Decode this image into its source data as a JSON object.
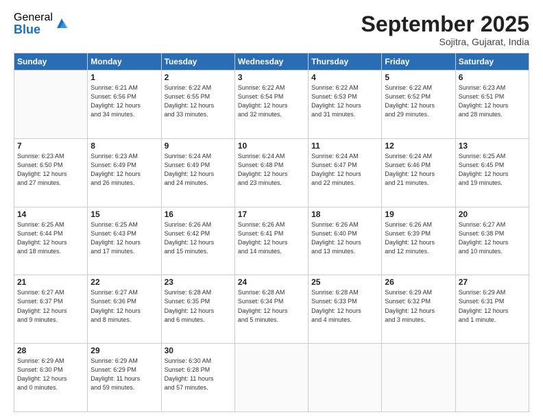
{
  "logo": {
    "general": "General",
    "blue": "Blue"
  },
  "header": {
    "month": "September 2025",
    "location": "Sojitra, Gujarat, India"
  },
  "weekdays": [
    "Sunday",
    "Monday",
    "Tuesday",
    "Wednesday",
    "Thursday",
    "Friday",
    "Saturday"
  ],
  "weeks": [
    [
      {
        "day": "",
        "info": ""
      },
      {
        "day": "1",
        "info": "Sunrise: 6:21 AM\nSunset: 6:56 PM\nDaylight: 12 hours\nand 34 minutes."
      },
      {
        "day": "2",
        "info": "Sunrise: 6:22 AM\nSunset: 6:55 PM\nDaylight: 12 hours\nand 33 minutes."
      },
      {
        "day": "3",
        "info": "Sunrise: 6:22 AM\nSunset: 6:54 PM\nDaylight: 12 hours\nand 32 minutes."
      },
      {
        "day": "4",
        "info": "Sunrise: 6:22 AM\nSunset: 6:53 PM\nDaylight: 12 hours\nand 31 minutes."
      },
      {
        "day": "5",
        "info": "Sunrise: 6:22 AM\nSunset: 6:52 PM\nDaylight: 12 hours\nand 29 minutes."
      },
      {
        "day": "6",
        "info": "Sunrise: 6:23 AM\nSunset: 6:51 PM\nDaylight: 12 hours\nand 28 minutes."
      }
    ],
    [
      {
        "day": "7",
        "info": "Sunrise: 6:23 AM\nSunset: 6:50 PM\nDaylight: 12 hours\nand 27 minutes."
      },
      {
        "day": "8",
        "info": "Sunrise: 6:23 AM\nSunset: 6:49 PM\nDaylight: 12 hours\nand 26 minutes."
      },
      {
        "day": "9",
        "info": "Sunrise: 6:24 AM\nSunset: 6:49 PM\nDaylight: 12 hours\nand 24 minutes."
      },
      {
        "day": "10",
        "info": "Sunrise: 6:24 AM\nSunset: 6:48 PM\nDaylight: 12 hours\nand 23 minutes."
      },
      {
        "day": "11",
        "info": "Sunrise: 6:24 AM\nSunset: 6:47 PM\nDaylight: 12 hours\nand 22 minutes."
      },
      {
        "day": "12",
        "info": "Sunrise: 6:24 AM\nSunset: 6:46 PM\nDaylight: 12 hours\nand 21 minutes."
      },
      {
        "day": "13",
        "info": "Sunrise: 6:25 AM\nSunset: 6:45 PM\nDaylight: 12 hours\nand 19 minutes."
      }
    ],
    [
      {
        "day": "14",
        "info": "Sunrise: 6:25 AM\nSunset: 6:44 PM\nDaylight: 12 hours\nand 18 minutes."
      },
      {
        "day": "15",
        "info": "Sunrise: 6:25 AM\nSunset: 6:43 PM\nDaylight: 12 hours\nand 17 minutes."
      },
      {
        "day": "16",
        "info": "Sunrise: 6:26 AM\nSunset: 6:42 PM\nDaylight: 12 hours\nand 15 minutes."
      },
      {
        "day": "17",
        "info": "Sunrise: 6:26 AM\nSunset: 6:41 PM\nDaylight: 12 hours\nand 14 minutes."
      },
      {
        "day": "18",
        "info": "Sunrise: 6:26 AM\nSunset: 6:40 PM\nDaylight: 12 hours\nand 13 minutes."
      },
      {
        "day": "19",
        "info": "Sunrise: 6:26 AM\nSunset: 6:39 PM\nDaylight: 12 hours\nand 12 minutes."
      },
      {
        "day": "20",
        "info": "Sunrise: 6:27 AM\nSunset: 6:38 PM\nDaylight: 12 hours\nand 10 minutes."
      }
    ],
    [
      {
        "day": "21",
        "info": "Sunrise: 6:27 AM\nSunset: 6:37 PM\nDaylight: 12 hours\nand 9 minutes."
      },
      {
        "day": "22",
        "info": "Sunrise: 6:27 AM\nSunset: 6:36 PM\nDaylight: 12 hours\nand 8 minutes."
      },
      {
        "day": "23",
        "info": "Sunrise: 6:28 AM\nSunset: 6:35 PM\nDaylight: 12 hours\nand 6 minutes."
      },
      {
        "day": "24",
        "info": "Sunrise: 6:28 AM\nSunset: 6:34 PM\nDaylight: 12 hours\nand 5 minutes."
      },
      {
        "day": "25",
        "info": "Sunrise: 6:28 AM\nSunset: 6:33 PM\nDaylight: 12 hours\nand 4 minutes."
      },
      {
        "day": "26",
        "info": "Sunrise: 6:29 AM\nSunset: 6:32 PM\nDaylight: 12 hours\nand 3 minutes."
      },
      {
        "day": "27",
        "info": "Sunrise: 6:29 AM\nSunset: 6:31 PM\nDaylight: 12 hours\nand 1 minute."
      }
    ],
    [
      {
        "day": "28",
        "info": "Sunrise: 6:29 AM\nSunset: 6:30 PM\nDaylight: 12 hours\nand 0 minutes."
      },
      {
        "day": "29",
        "info": "Sunrise: 6:29 AM\nSunset: 6:29 PM\nDaylight: 11 hours\nand 59 minutes."
      },
      {
        "day": "30",
        "info": "Sunrise: 6:30 AM\nSunset: 6:28 PM\nDaylight: 11 hours\nand 57 minutes."
      },
      {
        "day": "",
        "info": ""
      },
      {
        "day": "",
        "info": ""
      },
      {
        "day": "",
        "info": ""
      },
      {
        "day": "",
        "info": ""
      }
    ]
  ]
}
